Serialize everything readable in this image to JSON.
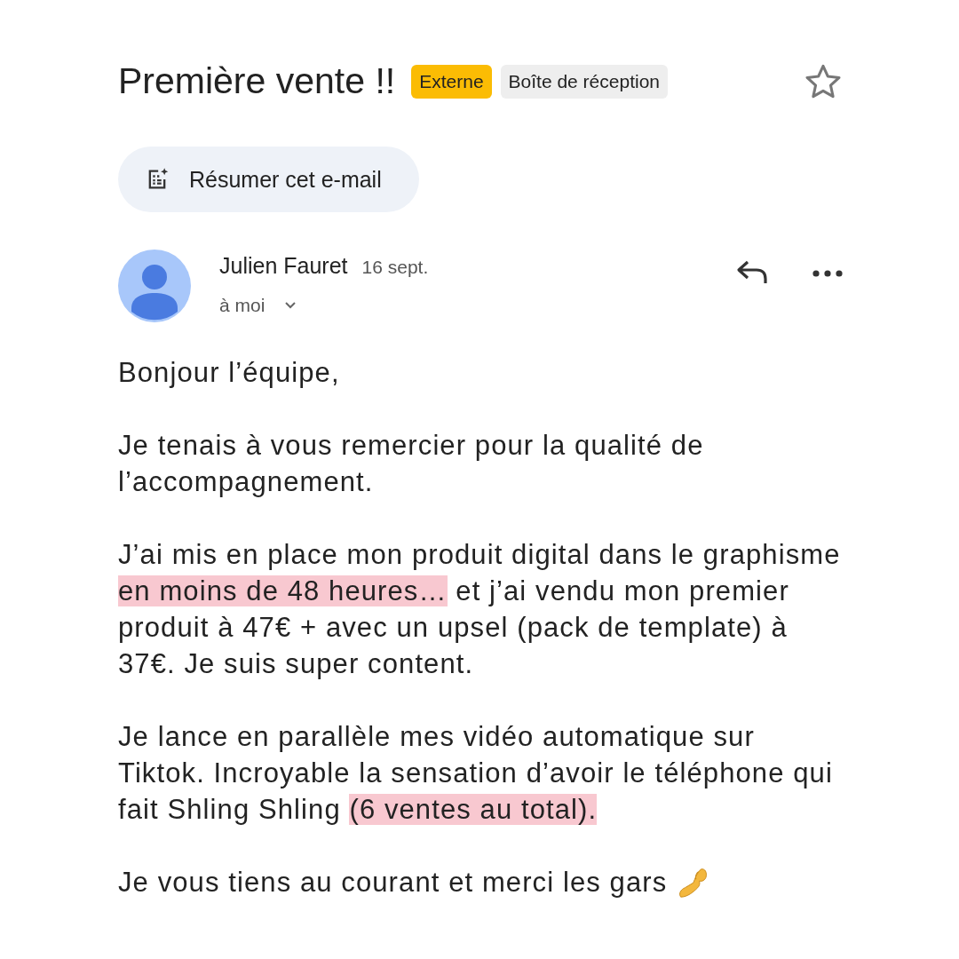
{
  "subject": "Première vente !!",
  "labels": [
    {
      "text": "Externe",
      "color": "#fbbc04"
    },
    {
      "text": "Boîte de réception",
      "color": "#eeeeee"
    }
  ],
  "starred": false,
  "summary_button": "Résumer cet e-mail",
  "sender": {
    "name": "Julien Fauret",
    "date": "16 sept.",
    "recipient": "à moi"
  },
  "body": [
    {
      "segments": [
        {
          "text": "Bonjour l’équipe,",
          "highlight": false
        }
      ]
    },
    {
      "segments": [
        {
          "text": "Je tenais à vous remercier pour la qualité de l’accompagnement.",
          "highlight": false
        }
      ]
    },
    {
      "segments": [
        {
          "text": "J’ai mis en place mon produit digital dans le graphisme ",
          "highlight": false
        },
        {
          "text": "en moins de 48 heures…",
          "highlight": true
        },
        {
          "text": " et j’ai vendu mon premier produit à 47€ + avec un upsel (pack de template) à 37€. Je suis super content.",
          "highlight": false
        }
      ]
    },
    {
      "segments": [
        {
          "text": "Je lance en parallèle mes vidéo automatique sur Tiktok. Incroyable la sensation d’avoir le téléphone qui fait Shling Shling ",
          "highlight": false
        },
        {
          "text": "(6 ventes au total).",
          "highlight": true
        }
      ]
    },
    {
      "segments": [
        {
          "text": "Je vous tiens au courant et merci les gars",
          "highlight": false
        }
      ],
      "kind": "emoji_end"
    }
  ]
}
